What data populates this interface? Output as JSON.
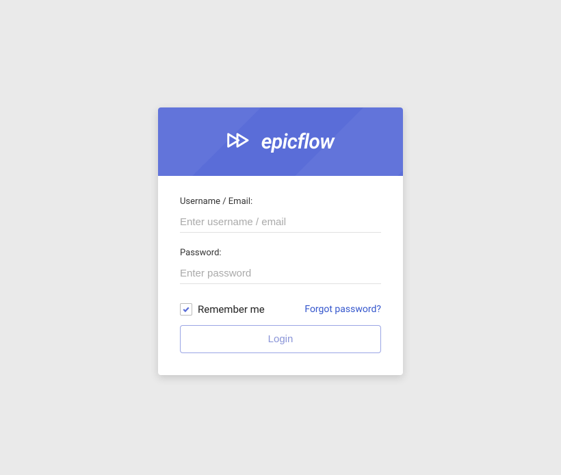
{
  "brand": {
    "name": "epicflow"
  },
  "form": {
    "username": {
      "label": "Username / Email:",
      "placeholder": "Enter username / email",
      "value": ""
    },
    "password": {
      "label": "Password:",
      "placeholder": "Enter password",
      "value": ""
    },
    "remember": {
      "label": "Remember me",
      "checked": true
    },
    "forgot_label": "Forgot password?",
    "submit_label": "Login"
  },
  "colors": {
    "brand_primary": "#5a6dd8",
    "page_bg": "#eaeaea",
    "link": "#3355cc"
  }
}
